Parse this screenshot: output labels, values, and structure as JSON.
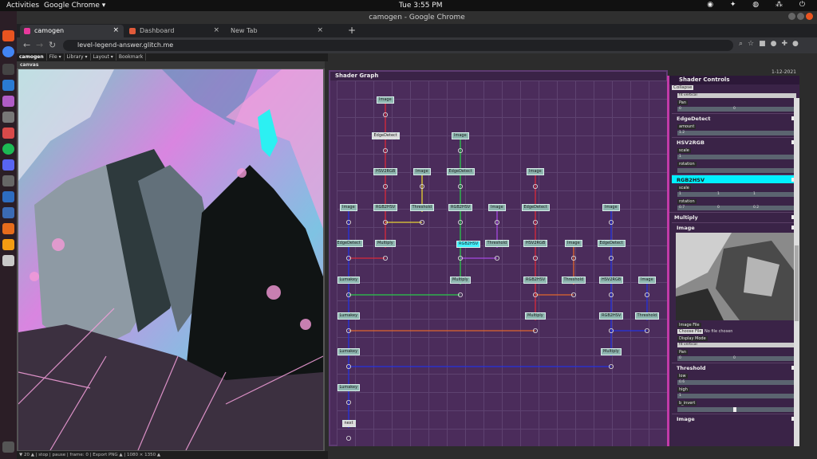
{
  "os": {
    "activities": "Activities",
    "app": "Google Chrome ▾",
    "clock": "Tue   3:55 PM",
    "tray": "◉ ✦ ◍ ⁂ ⏻"
  },
  "window": {
    "title": "camogen - Google Chrome"
  },
  "tabs": [
    {
      "label": "camogen",
      "color": "#e8399c"
    },
    {
      "label": "Dashboard",
      "color": "#e05a3a"
    },
    {
      "label": "New Tab",
      "color": ""
    }
  ],
  "newtab": "+",
  "omnibox": {
    "url": "level-legend-answer.glitch.me"
  },
  "app": {
    "brand": "camogen",
    "menus": [
      "File ▾",
      "Library ▾",
      "Layout ▾",
      "Bookmark"
    ],
    "canvas_title": "canvas",
    "status": "▼ 20 ▲  |  stop | pause | frame: 0  |  Export PNG ▲  |  1080 × 1350 ▲",
    "date": "1-12-2021"
  },
  "graph": {
    "title": "Shader Graph",
    "nodes": [
      {
        "label": "Image",
        "col": 1,
        "row": 0
      },
      {
        "label": "EdgeDetect",
        "col": 1,
        "row": 1,
        "style": "dark"
      },
      {
        "label": "Image",
        "col": 3,
        "row": 1
      },
      {
        "label": "HSV2RGB",
        "col": 1,
        "row": 2
      },
      {
        "label": "Image",
        "col": 2,
        "row": 2
      },
      {
        "label": "EdgeDetect",
        "col": 3,
        "row": 2
      },
      {
        "label": "Image",
        "col": 5,
        "row": 2
      },
      {
        "label": "Image",
        "col": 0,
        "row": 3
      },
      {
        "label": "RGB2HSV",
        "col": 1,
        "row": 3
      },
      {
        "label": "Threshold",
        "col": 2,
        "row": 3
      },
      {
        "label": "RGB2HSV",
        "col": 3,
        "row": 3
      },
      {
        "label": "Image",
        "col": 4,
        "row": 3
      },
      {
        "label": "EdgeDetect",
        "col": 5,
        "row": 3
      },
      {
        "label": "Image",
        "col": 7,
        "row": 3
      },
      {
        "label": "EdgeDetect",
        "col": 0,
        "row": 4
      },
      {
        "label": "Multiply",
        "col": 1,
        "row": 4
      },
      {
        "label": "RGB2HSV",
        "col": 3,
        "row": 4,
        "style": "sel"
      },
      {
        "label": "Threshold",
        "col": 4,
        "row": 4
      },
      {
        "label": "HSV2RGB",
        "col": 5,
        "row": 4
      },
      {
        "label": "Image",
        "col": 6,
        "row": 4
      },
      {
        "label": "EdgeDetect",
        "col": 7,
        "row": 4
      },
      {
        "label": "Lumakey",
        "col": 0,
        "row": 5
      },
      {
        "label": "Multiply",
        "col": 3,
        "row": 5
      },
      {
        "label": "RGB2HSV",
        "col": 5,
        "row": 5
      },
      {
        "label": "Threshold",
        "col": 6,
        "row": 5
      },
      {
        "label": "HSV2RGB",
        "col": 7,
        "row": 5
      },
      {
        "label": "Image",
        "col": 8,
        "row": 5
      },
      {
        "label": "Lumakey",
        "col": 0,
        "row": 6
      },
      {
        "label": "Multiply",
        "col": 5,
        "row": 6
      },
      {
        "label": "RGB2HSV",
        "col": 7,
        "row": 6
      },
      {
        "label": "Threshold",
        "col": 8,
        "row": 6
      },
      {
        "label": "Lumakey",
        "col": 0,
        "row": 7
      },
      {
        "label": "Multiply",
        "col": 7,
        "row": 7
      },
      {
        "label": "Lumakey",
        "col": 0,
        "row": 8
      },
      {
        "label": "next",
        "col": 0,
        "row": 9,
        "style": "dark"
      }
    ],
    "colors": {
      "red": "#d92a3a",
      "green": "#29c84a",
      "blue": "#2433e0",
      "yellow": "#e6d233",
      "orange": "#e0662e",
      "purple": "#a54ae0"
    }
  },
  "controls": {
    "title": "Shader Controls",
    "collapse": "Collapse",
    "top_select": "fit vertical",
    "top_pan_label": "Pan",
    "top_pan_values": [
      "0",
      "0"
    ],
    "edgedetect": {
      "title": "EdgeDetect",
      "amount_label": "amount",
      "amount": "1.2"
    },
    "hsv2rgb": {
      "title": "HSV2RGB",
      "scale_label": "scale",
      "scale": "1",
      "rotation_label": "rotation",
      "rotation": ""
    },
    "rgb2hsv": {
      "title": "RGB2HSV",
      "scale_label": "scale",
      "scale_values": [
        "1",
        "1",
        "1"
      ],
      "rotation_label": "rotation",
      "rotation_values": [
        "0.7",
        "0",
        "0.2"
      ]
    },
    "multiply": {
      "title": "Multiply"
    },
    "image": {
      "title": "Image",
      "file_label": "Image File",
      "choose": "Choose File",
      "nofile": "No file chosen",
      "display_label": "Display Mode",
      "display": "fit vertical",
      "pan_label": "Pan",
      "pan_values": [
        "0",
        "0"
      ]
    },
    "threshold": {
      "title": "Threshold",
      "low_label": "low",
      "low": "0.6",
      "high_label": "high",
      "high": "1",
      "invert_label": "b_invert"
    },
    "image2": {
      "title": "Image"
    }
  }
}
